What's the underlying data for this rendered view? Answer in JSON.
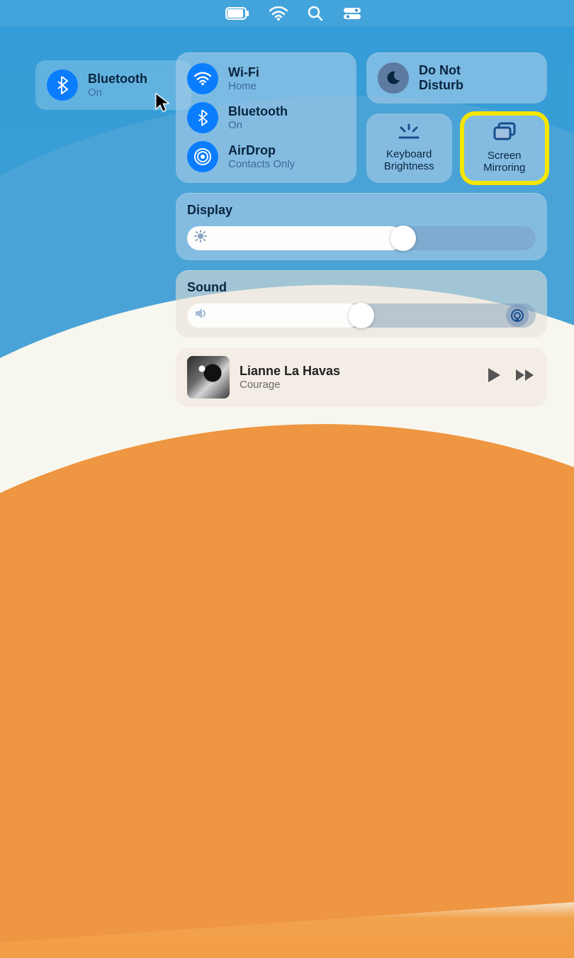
{
  "tooltip": {
    "title": "Bluetooth",
    "status": "On"
  },
  "network": {
    "wifi": {
      "title": "Wi-Fi",
      "sub": "Home"
    },
    "bluetooth": {
      "title": "Bluetooth",
      "sub": "On"
    },
    "airdrop": {
      "title": "AirDrop",
      "sub": "Contacts Only"
    }
  },
  "dnd": {
    "title_line1": "Do Not",
    "title_line2": "Disturb"
  },
  "mini": {
    "kb_line1": "Keyboard",
    "kb_line2": "Brightness",
    "sm_line1": "Screen",
    "sm_line2": "Mirroring"
  },
  "display": {
    "label": "Display",
    "percent": 62
  },
  "sound": {
    "label": "Sound",
    "percent": 50
  },
  "now_playing": {
    "title": "Lianne La Havas",
    "subtitle": "Courage"
  },
  "colors": {
    "accent": "#0a7dff",
    "highlight": "#f5e600"
  }
}
